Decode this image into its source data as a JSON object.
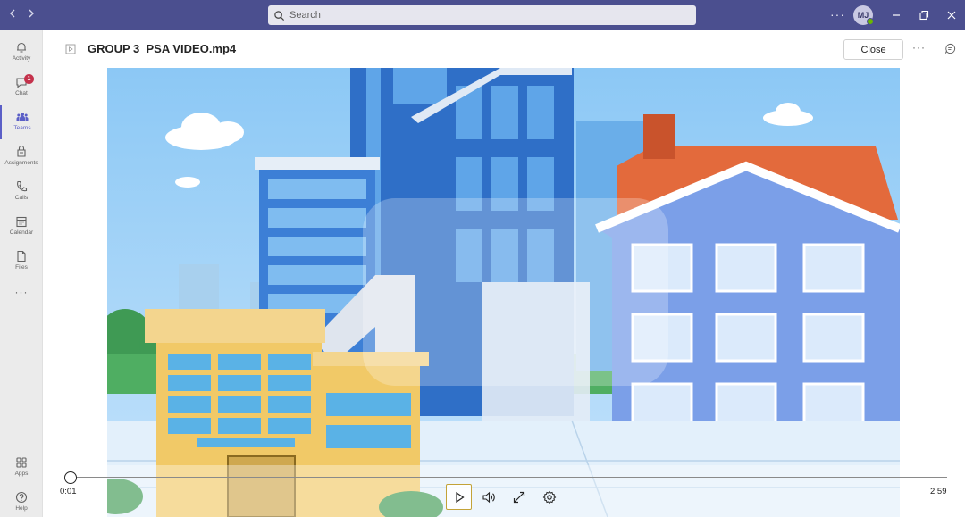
{
  "titlebar": {
    "back_icon": "chevron-left-icon",
    "forward_icon": "chevron-right-icon",
    "search_placeholder": "Search",
    "more": "···",
    "avatar_initials": "MJ",
    "presence_color": "#6bb700",
    "bar_color": "#4b4f8f"
  },
  "rail": {
    "items": [
      {
        "label": "Activity",
        "icon": "bell-icon"
      },
      {
        "label": "Chat",
        "icon": "chat-icon",
        "badge": "1"
      },
      {
        "label": "Teams",
        "icon": "teams-icon",
        "active": true
      },
      {
        "label": "Assignments",
        "icon": "assignments-icon"
      },
      {
        "label": "Calls",
        "icon": "phone-icon"
      },
      {
        "label": "Calendar",
        "icon": "calendar-icon"
      },
      {
        "label": "Files",
        "icon": "file-icon"
      }
    ],
    "more": "···",
    "bottom": [
      {
        "label": "Apps",
        "icon": "apps-icon"
      },
      {
        "label": "Help",
        "icon": "help-icon"
      }
    ],
    "accent": "#5b5fc7"
  },
  "header": {
    "file_name": "GROUP 3_PSA VIDEO.mp4",
    "close_label": "Close",
    "more": "···"
  },
  "player": {
    "current_time": "0:01",
    "duration": "2:59",
    "progress": 0.006,
    "controls": [
      "play-icon",
      "volume-icon",
      "fullscreen-icon",
      "settings-icon"
    ]
  }
}
